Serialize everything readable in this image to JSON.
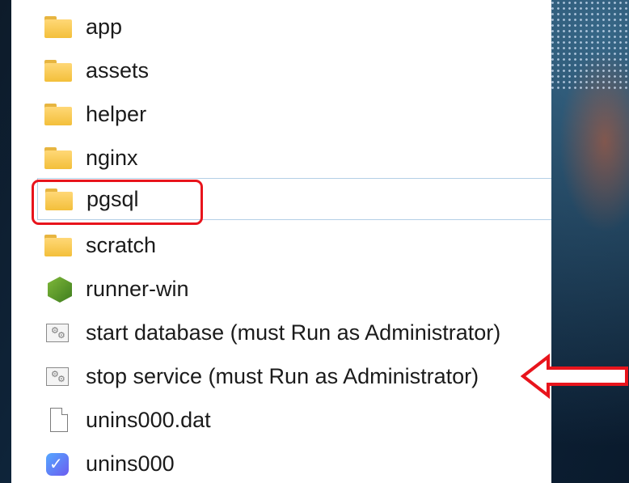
{
  "file_list": {
    "items": [
      {
        "label": "app",
        "icon": "folder-icon"
      },
      {
        "label": "assets",
        "icon": "folder-icon"
      },
      {
        "label": "helper",
        "icon": "folder-icon"
      },
      {
        "label": "nginx",
        "icon": "folder-icon"
      },
      {
        "label": "pgsql",
        "icon": "folder-icon",
        "selected": true
      },
      {
        "label": "scratch",
        "icon": "folder-icon"
      },
      {
        "label": "runner-win",
        "icon": "node-hexagon-icon"
      },
      {
        "label": "start database (must Run as Administrator)",
        "icon": "config-file-icon"
      },
      {
        "label": "stop service (must Run as Administrator)",
        "icon": "config-file-icon"
      },
      {
        "label": "unins000.dat",
        "icon": "blank-file-icon"
      },
      {
        "label": "unins000",
        "icon": "uninstaller-icon"
      }
    ]
  },
  "annotations": {
    "highlight_color": "#e8141c",
    "selection_border_color": "#b4cfe6"
  }
}
